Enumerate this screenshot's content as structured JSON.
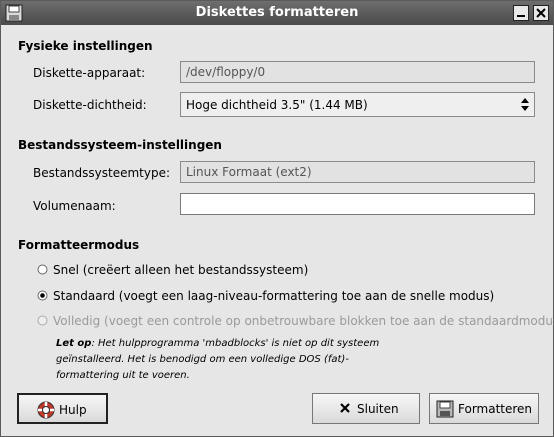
{
  "window": {
    "title": "Diskettes formatteren"
  },
  "physical": {
    "heading": "Fysieke instellingen",
    "device_label": "Diskette-apparaat:",
    "device_value": "/dev/floppy/0",
    "density_label": "Diskette-dichtheid:",
    "density_value": "Hoge dichtheid 3.5\" (1.44 MB)"
  },
  "filesystem": {
    "heading": "Bestandssysteem-instellingen",
    "type_label": "Bestandssysteemtype:",
    "type_value": "Linux Formaat (ext2)",
    "volume_label": "Volumenaam:",
    "volume_value": ""
  },
  "mode": {
    "heading": "Formatteermodus",
    "options": [
      {
        "label": "Snel (creëert alleen het bestandssysteem)",
        "selected": false,
        "enabled": true
      },
      {
        "label": "Standaard (voegt een laag-niveau-formattering toe aan de snelle modus)",
        "selected": true,
        "enabled": true
      },
      {
        "label": "Volledig (voegt een controle op onbetrouwbare blokken toe aan de standaardmodus)",
        "selected": false,
        "enabled": false
      }
    ],
    "note_bold": "Let op",
    "note_rest": ": Het hulpprogramma 'mbadblocks' is niet op dit systeem geïnstalleerd. Het is benodigd om een volledige DOS (fat)-formattering uit te voeren."
  },
  "buttons": {
    "help": "Hulp",
    "close": "Sluiten",
    "format": "Formatteren"
  }
}
